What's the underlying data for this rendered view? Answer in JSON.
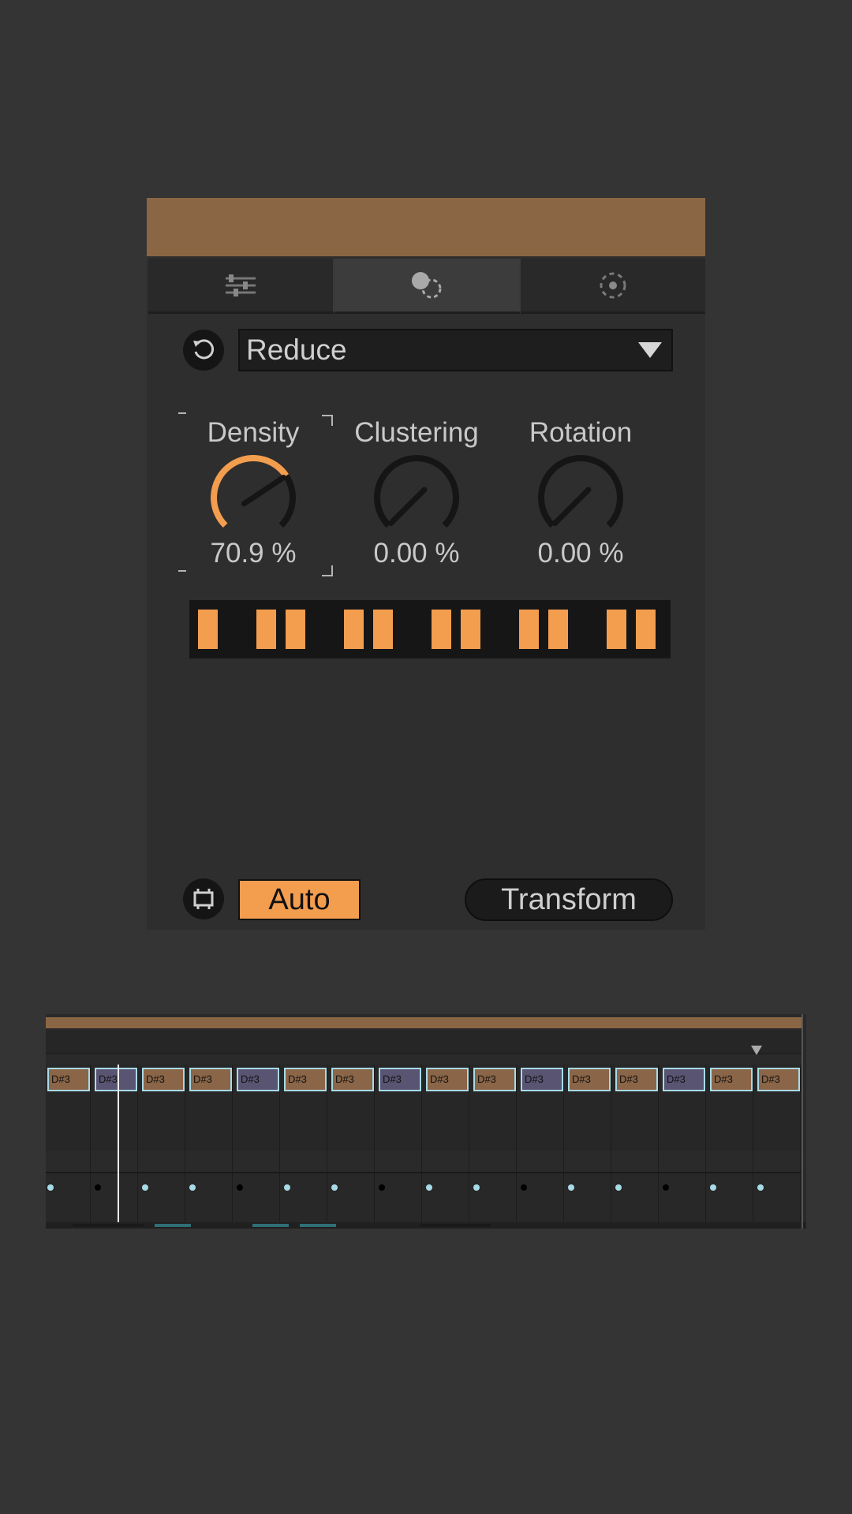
{
  "device": {
    "tabs": [
      {
        "icon": "sliders-icon",
        "active": false
      },
      {
        "icon": "dots-transform-icon",
        "active": true
      },
      {
        "icon": "dashed-circle-icon",
        "active": false
      }
    ],
    "mode": {
      "selected": "Reduce",
      "reset_icon": "reset-icon"
    },
    "params": [
      {
        "name": "Density",
        "value_text": "70.9 %",
        "value": 70.9
      },
      {
        "name": "Clustering",
        "value_text": "0.00 %",
        "value": 0.0
      },
      {
        "name": "Rotation",
        "value_text": "0.00 %",
        "value": 0.0
      }
    ],
    "pattern": [
      1,
      0,
      1,
      1,
      0,
      1,
      1,
      0,
      1,
      1,
      0,
      1,
      1,
      0,
      1,
      1
    ],
    "auto_label": "Auto",
    "transform_label": "Transform",
    "clip_icon": "clip-icon"
  },
  "clip": {
    "notes": [
      {
        "label": "D#3",
        "color": "brown"
      },
      {
        "label": "D#3",
        "color": "purple"
      },
      {
        "label": "D#3",
        "color": "brown"
      },
      {
        "label": "D#3",
        "color": "brown"
      },
      {
        "label": "D#3",
        "color": "purple"
      },
      {
        "label": "D#3",
        "color": "brown"
      },
      {
        "label": "D#3",
        "color": "brown"
      },
      {
        "label": "D#3",
        "color": "purple"
      },
      {
        "label": "D#3",
        "color": "brown"
      },
      {
        "label": "D#3",
        "color": "brown"
      },
      {
        "label": "D#3",
        "color": "purple"
      },
      {
        "label": "D#3",
        "color": "brown"
      },
      {
        "label": "D#3",
        "color": "brown"
      },
      {
        "label": "D#3",
        "color": "purple"
      },
      {
        "label": "D#3",
        "color": "brown"
      },
      {
        "label": "D#3",
        "color": "brown"
      }
    ],
    "velocity_active": [
      true,
      false,
      true,
      true,
      false,
      true,
      true,
      false,
      true,
      true,
      false,
      true,
      true,
      false,
      true,
      true
    ]
  },
  "colors": {
    "accent": "#f39d4f",
    "title_bar": "#8b6644",
    "note_brown": "#8a6547",
    "note_purple": "#5a5473",
    "note_border": "#a8dbe8",
    "velocity_active": "#a8dbe8",
    "velocity_inactive": "#000000"
  }
}
